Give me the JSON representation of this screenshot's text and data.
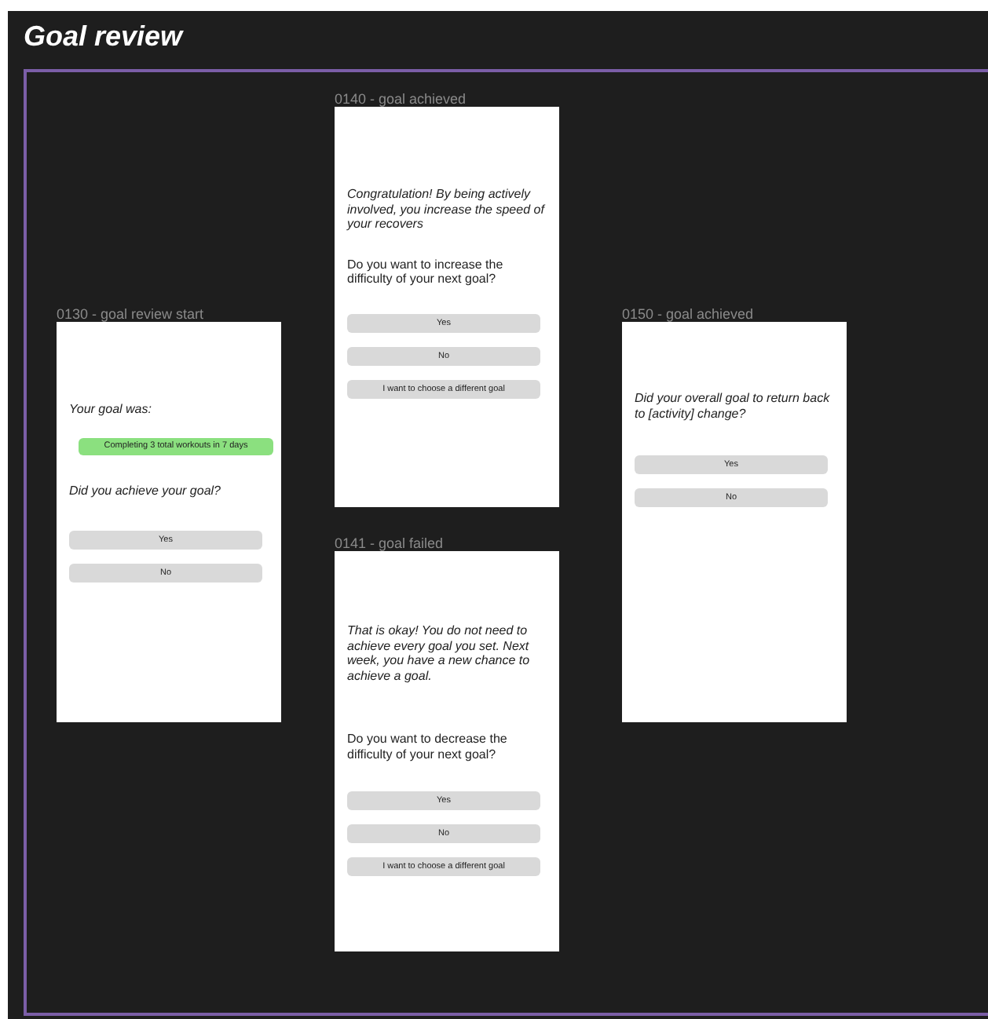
{
  "page": {
    "title": "Goal review"
  },
  "frames": [
    {
      "label": "0130 - goal review start",
      "items": [
        {
          "kind": "italic-text",
          "text": "Your goal was:"
        },
        {
          "kind": "goal-chip",
          "text": "Completing 3 total workouts in 7 days"
        },
        {
          "kind": "italic-text",
          "text": "Did you achieve your goal?"
        },
        {
          "kind": "button",
          "text": "Yes"
        },
        {
          "kind": "button",
          "text": "No"
        }
      ]
    },
    {
      "label": "0140 - goal achieved",
      "items": [
        {
          "kind": "italic-text",
          "text": "Congratulation! By being actively involved, you increase the speed of your recovers"
        },
        {
          "kind": "text",
          "text": "Do you want to increase the difficulty of your next goal?"
        },
        {
          "kind": "button",
          "text": "Yes"
        },
        {
          "kind": "button",
          "text": "No"
        },
        {
          "kind": "button",
          "text": "I want to choose a different goal"
        }
      ]
    },
    {
      "label": "0141 - goal failed",
      "items": [
        {
          "kind": "italic-text",
          "text": "That is okay! You do not need to achieve every goal you set. Next week, you have a new chance to achieve a goal."
        },
        {
          "kind": "text",
          "text": "Do you want to decrease the difficulty of your next goal?"
        },
        {
          "kind": "button",
          "text": "Yes"
        },
        {
          "kind": "button",
          "text": "No"
        },
        {
          "kind": "button",
          "text": "I want to choose a different goal"
        }
      ]
    },
    {
      "label": "0150 - goal achieved",
      "items": [
        {
          "kind": "italic-text",
          "text": "Did your overall goal to return back to [activity] change?"
        },
        {
          "kind": "button",
          "text": "Yes"
        },
        {
          "kind": "button",
          "text": "No"
        }
      ]
    }
  ]
}
